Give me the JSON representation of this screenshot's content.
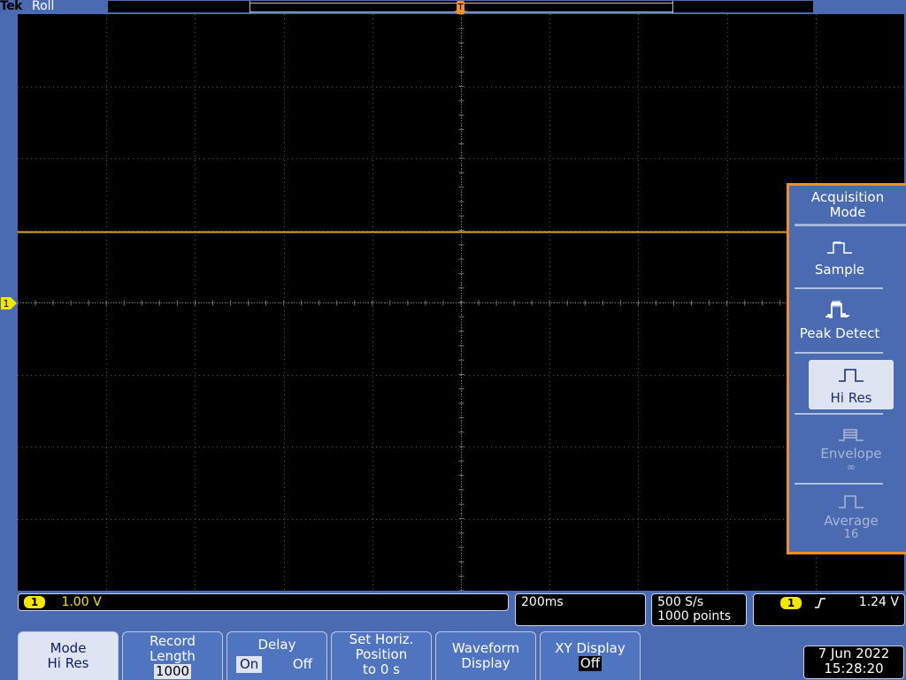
{
  "header": {
    "brand": "Tek",
    "acq_state": "Roll"
  },
  "trigger_marker": "T",
  "channel1": {
    "marker_label": "1",
    "color": "#d8a32a",
    "scale": "1.00 V",
    "badge": "1"
  },
  "side_menu": {
    "title_line1": "Acquisition",
    "title_line2": "Mode",
    "items": [
      {
        "label": "Sample",
        "icon": "sample-waveform-icon",
        "enabled": true,
        "selected": false
      },
      {
        "label": "Peak Detect",
        "icon": "peak-detect-waveform-icon",
        "enabled": true,
        "selected": false
      },
      {
        "label": "Hi Res",
        "icon": "hi-res-waveform-icon",
        "enabled": true,
        "selected": true
      },
      {
        "label": "Envelope",
        "sub": "∞",
        "icon": "envelope-waveform-icon",
        "enabled": false,
        "selected": false
      },
      {
        "label": "Average",
        "sub": "16",
        "icon": "average-waveform-icon",
        "enabled": false,
        "selected": false
      }
    ],
    "accent": "#ef8f2a"
  },
  "status": {
    "timebase": "200ms",
    "sample_rate": "500 S/s",
    "record_points": "1000 points",
    "trigger_source": "1",
    "trigger_slope_icon": "rising-edge-icon",
    "trigger_level": "1.24 V"
  },
  "bottom_menu": {
    "mode": {
      "label": "Mode",
      "value": "Hi Res"
    },
    "record_length": {
      "line1": "Record",
      "line2": "Length",
      "value": "1000"
    },
    "delay": {
      "label": "Delay",
      "on": "On",
      "off": "Off"
    },
    "set_horiz": {
      "line1": "Set Horiz.",
      "line2": "Position",
      "line3": "to 0 s"
    },
    "waveform_display": {
      "line1": "Waveform",
      "line2": "Display"
    },
    "xy_display": {
      "label": "XY Display",
      "value": "Off"
    }
  },
  "datetime": {
    "date": "7 Jun 2022",
    "time": "15:28:20"
  },
  "colors": {
    "background": "#4a6bb1",
    "graticule": "#000000",
    "trace": "#d8a32a",
    "badge": "#f3e600"
  }
}
